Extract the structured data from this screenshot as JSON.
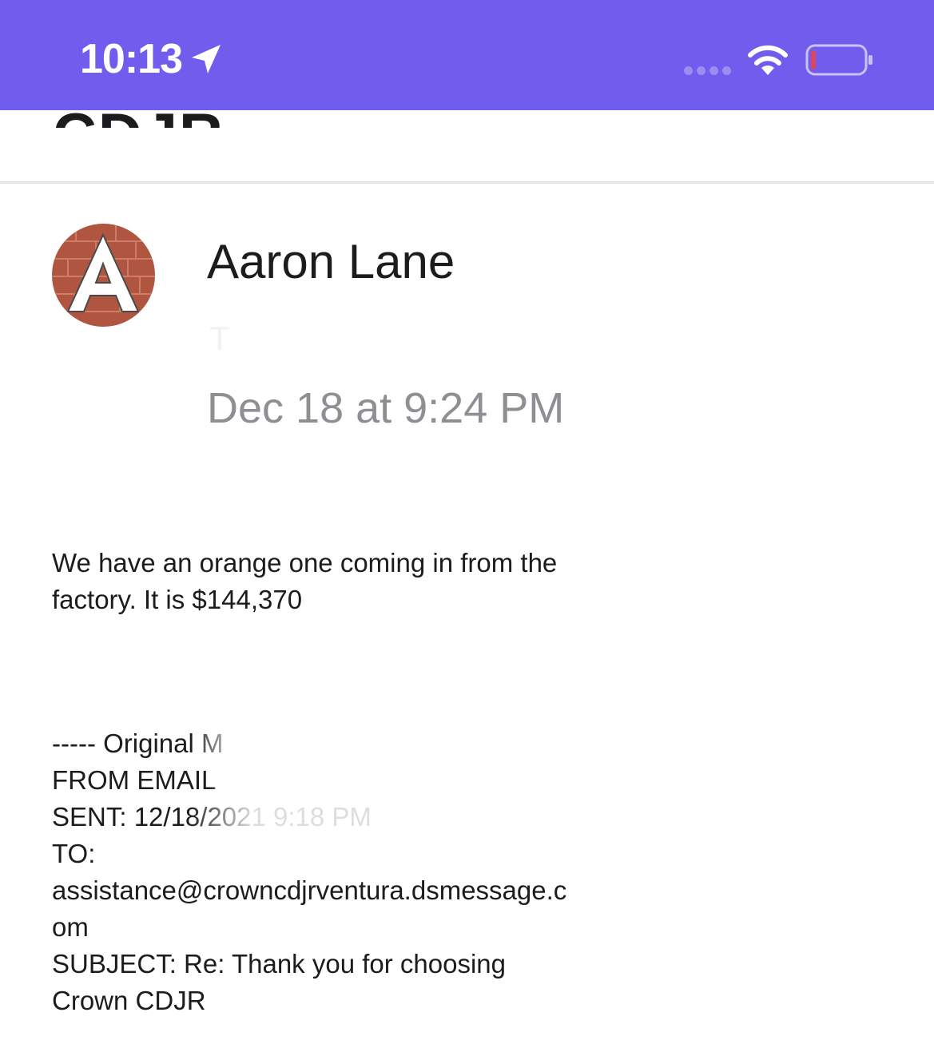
{
  "status_bar": {
    "time": "10:13",
    "background_color": "#715ded",
    "icons": [
      "location-arrow-icon",
      "signal-dots-icon",
      "wifi-icon",
      "battery-low-icon"
    ]
  },
  "header": {
    "title_partial": "CDJR"
  },
  "email": {
    "sender_name": "Aaron Lane",
    "avatar_letter": "A",
    "recipient_partial": "T",
    "date": "Dec 18 at 9:24 PM",
    "body_line_1": "We have an orange one coming in from the",
    "body_line_2": "factory. It is $144,370",
    "original": {
      "divider_label": "----- Original M",
      "from_label": "FROM EMAIL",
      "sent_label": "SENT: 12/18/2021 9:18 PM",
      "to_label": "TO:",
      "to_address_line_1": "assistance@crowncdjrventura.dsmessage.c",
      "to_address_line_2": "om",
      "subject_line_1": "SUBJECT: Re: Thank you for choosing",
      "subject_line_2": "Crown CDJR"
    }
  }
}
